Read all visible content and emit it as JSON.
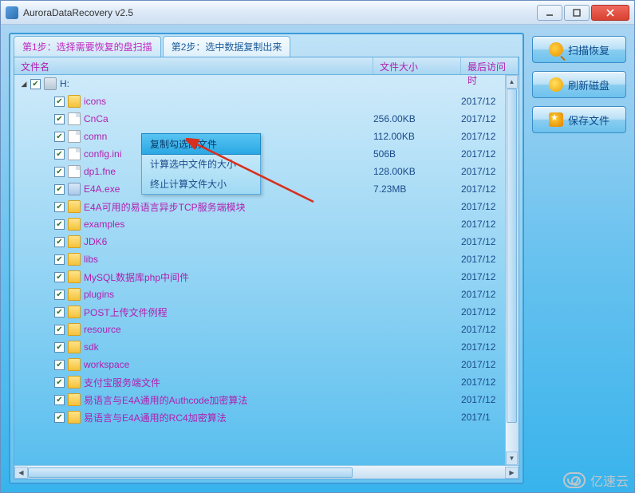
{
  "app": {
    "title": "AuroraDataRecovery v2.5"
  },
  "tabs": {
    "step1": "第1步：选择需要恢复的盘扫描",
    "step2": "第2步：选中数据复制出来"
  },
  "columns": {
    "name": "文件名",
    "size": "文件大小",
    "date": "最后访问时"
  },
  "drive": {
    "label": "H:"
  },
  "rows": [
    {
      "name": "icons",
      "type": "folder",
      "size": "",
      "date": "2017/12"
    },
    {
      "name": "CnCa",
      "type": "file",
      "size": "256.00KB",
      "date": "2017/12"
    },
    {
      "name": "comn",
      "type": "file",
      "size": "112.00KB",
      "date": "2017/12"
    },
    {
      "name": "config.ini",
      "type": "file",
      "size": "506B",
      "date": "2017/12"
    },
    {
      "name": "dp1.fne",
      "type": "file",
      "size": "128.00KB",
      "date": "2017/12"
    },
    {
      "name": "E4A.exe",
      "type": "exe",
      "size": "7.23MB",
      "date": "2017/12"
    },
    {
      "name": "E4A可用的易语言异步TCP服务端模块",
      "type": "folder",
      "size": "",
      "date": "2017/12"
    },
    {
      "name": "examples",
      "type": "folder",
      "size": "",
      "date": "2017/12"
    },
    {
      "name": "JDK6",
      "type": "folder",
      "size": "",
      "date": "2017/12"
    },
    {
      "name": "libs",
      "type": "folder",
      "size": "",
      "date": "2017/12"
    },
    {
      "name": "MySQL数据库php中间件",
      "type": "folder",
      "size": "",
      "date": "2017/12"
    },
    {
      "name": "plugins",
      "type": "folder",
      "size": "",
      "date": "2017/12"
    },
    {
      "name": "POST上传文件例程",
      "type": "folder",
      "size": "",
      "date": "2017/12"
    },
    {
      "name": "resource",
      "type": "folder",
      "size": "",
      "date": "2017/12"
    },
    {
      "name": "sdk",
      "type": "folder",
      "size": "",
      "date": "2017/12"
    },
    {
      "name": "workspace",
      "type": "folder",
      "size": "",
      "date": "2017/12"
    },
    {
      "name": "支付宝服务端文件",
      "type": "folder",
      "size": "",
      "date": "2017/12"
    },
    {
      "name": "易语言与E4A通用的Authcode加密算法",
      "type": "folder",
      "size": "",
      "date": "2017/12"
    },
    {
      "name": "易语言与E4A通用的RC4加密算法",
      "type": "folder",
      "size": "",
      "date": "2017/1"
    }
  ],
  "context_menu": {
    "copy_checked": "复制勾选的文件",
    "calc_size": "计算选中文件的大小",
    "stop_calc": "终止计算文件大小"
  },
  "sidebar": {
    "scan": "扫描恢复",
    "refresh": "刷新磁盘",
    "save": "保存文件"
  },
  "watermark": "亿速云"
}
